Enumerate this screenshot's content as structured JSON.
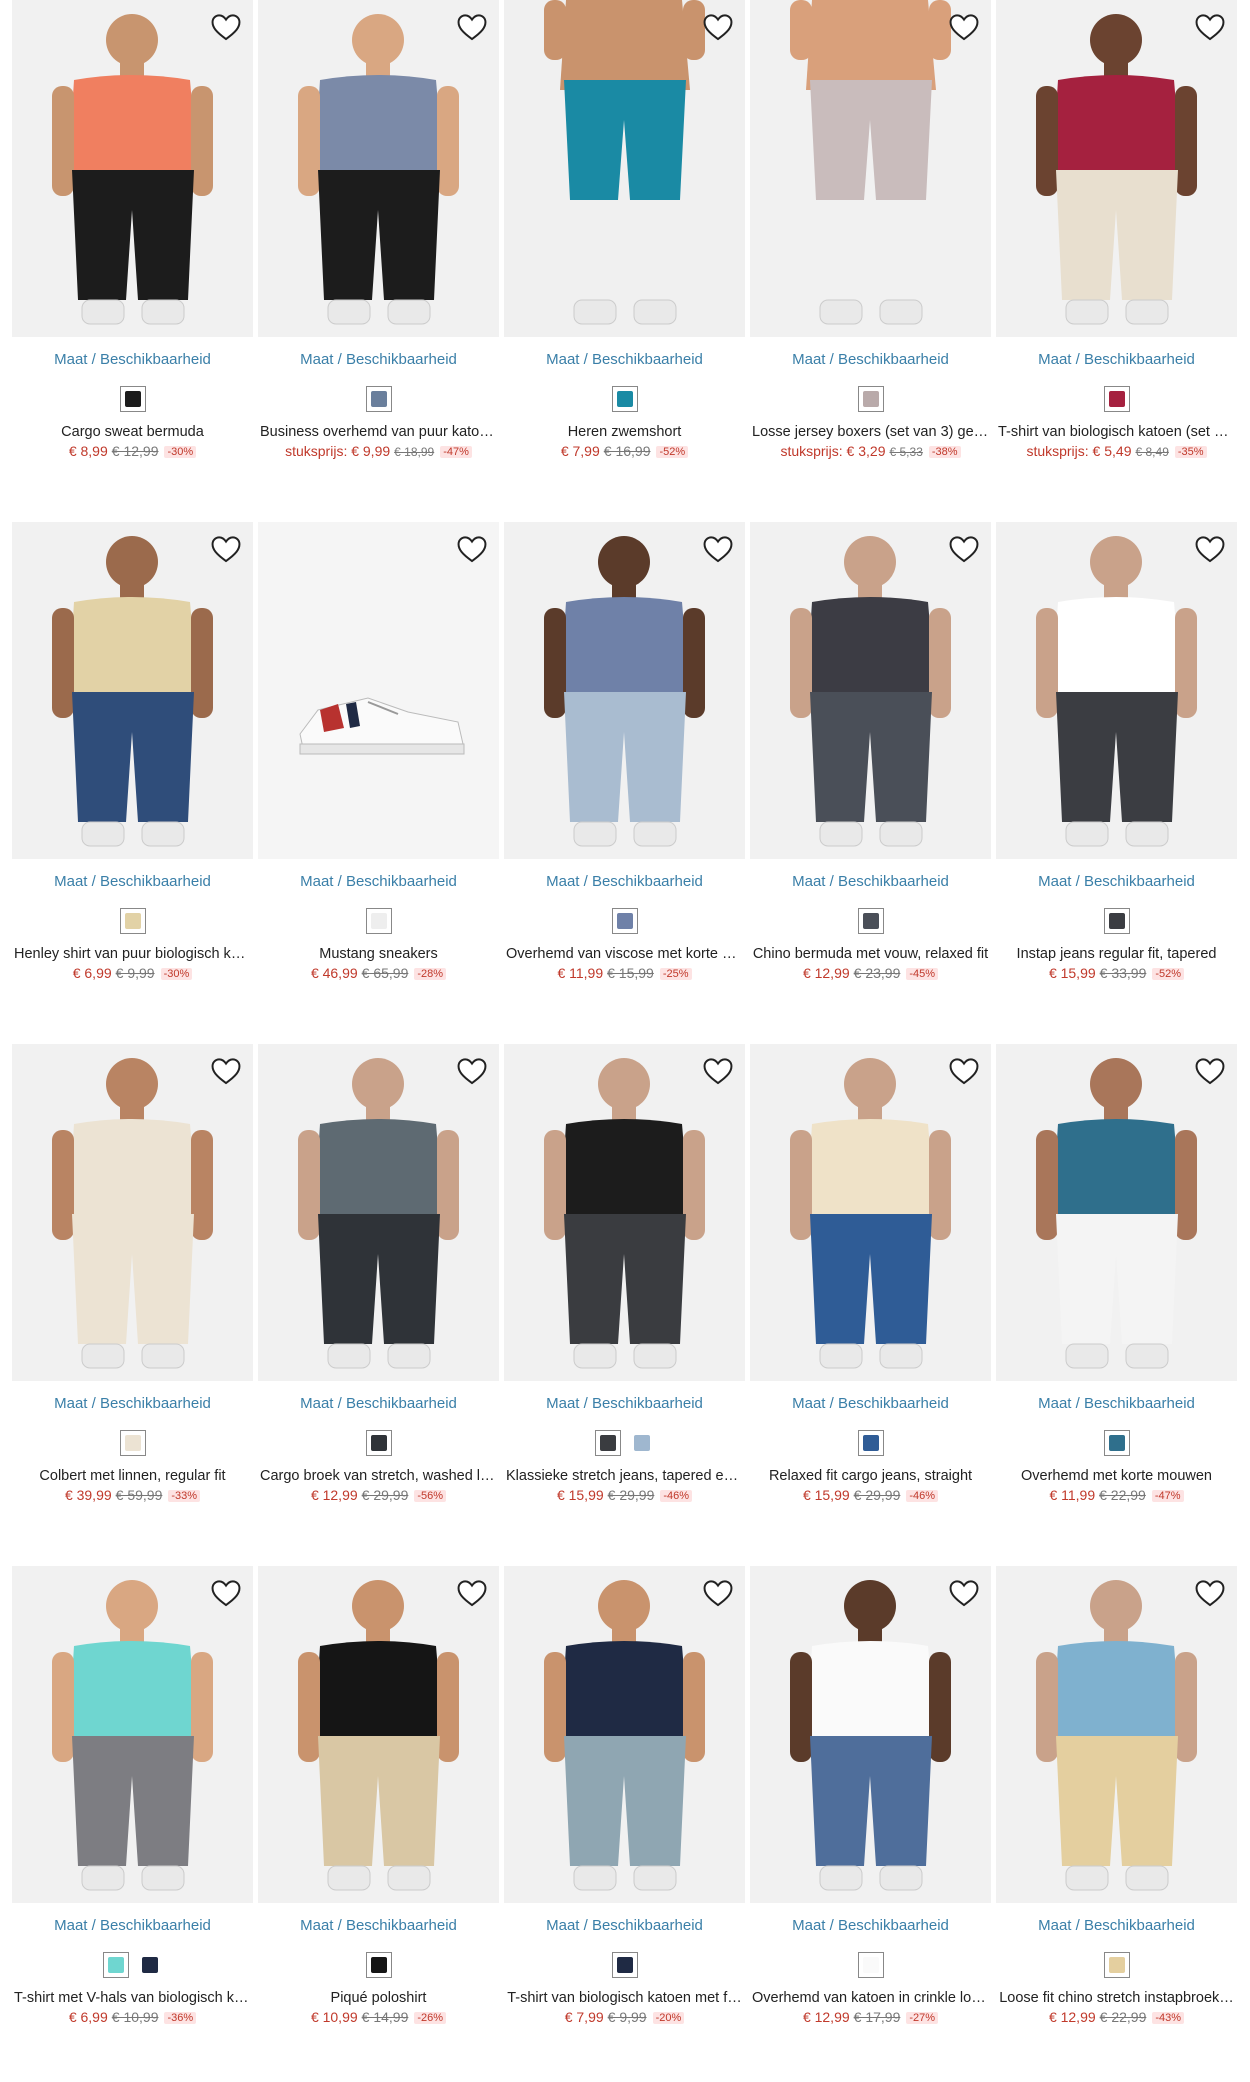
{
  "maat_label": "Maat / Beschikbaarheid",
  "products": [
    {
      "name": "Cargo sweat bermuda",
      "price": "€ 8,99",
      "old": "€ 12,99",
      "badge": "-30%",
      "bg": "#f1f1f1",
      "top": "#f07f60",
      "bottom": "#1c1c1c",
      "skin": "#c8956f",
      "swatches": [
        "#1c1c1c"
      ]
    },
    {
      "name": "Business overhemd van puur katoe…",
      "price": "stuksprijs: € 9,99",
      "old": "€ 18,99",
      "badge": "-47%",
      "bg": "#f1f1f1",
      "top": "#7b8aa8",
      "bottom": "#1c1c1c",
      "skin": "#d9a782",
      "swatches": [
        "#6a7f9c"
      ]
    },
    {
      "name": "Heren zwemshort",
      "price": "€ 7,99",
      "old": "€ 16,99",
      "badge": "-52%",
      "bg": "#f0f0f0",
      "top": "#c9936d",
      "bottom": "#1a8aa4",
      "skin": "#c9936d",
      "swatches": [
        "#1a8aa4"
      ]
    },
    {
      "name": "Losse jersey boxers (set van 3) geruit",
      "price": "stuksprijs: € 3,29",
      "old": "€ 5,33",
      "badge": "-38%",
      "bg": "#f1f1f1",
      "top": "#d9a07b",
      "bottom": "#c9bcbc",
      "skin": "#d9a07b",
      "swatches": [
        "#b9aaaa"
      ]
    },
    {
      "name": "T-shirt van biologisch katoen (set va…",
      "price": "stuksprijs: € 5,49",
      "old": "€ 8,49",
      "badge": "-35%",
      "bg": "#f1f1f1",
      "top": "#a5213f",
      "bottom": "#e8dfcf",
      "skin": "#6b4330",
      "swatches": [
        "#a5213f"
      ]
    },
    {
      "name": "Henley shirt van puur biologisch ka…",
      "price": "€ 6,99",
      "old": "€ 9,99",
      "badge": "-30%",
      "bg": "#f1f1f1",
      "top": "#e2d2a6",
      "bottom": "#2f4d7a",
      "skin": "#9b6a4c",
      "swatches": [
        "#e2d2a6"
      ]
    },
    {
      "name": "Mustang sneakers",
      "price": "€ 46,99",
      "old": "€ 65,99",
      "badge": "-28%",
      "bg": "#f5f5f5",
      "top": "#f5f5f5",
      "bottom": "#f5f5f5",
      "skin": "#f5f5f5",
      "swatches": [
        "#eeeeee"
      ],
      "shoe": true
    },
    {
      "name": "Overhemd van viscose met korte m…",
      "price": "€ 11,99",
      "old": "€ 15,99",
      "badge": "-25%",
      "bg": "#f1f1f1",
      "top": "#6f81a8",
      "bottom": "#a9bcd0",
      "skin": "#5b3b2a",
      "swatches": [
        "#6f81a8"
      ]
    },
    {
      "name": "Chino bermuda met vouw, relaxed fit",
      "price": "€ 12,99",
      "old": "€ 23,99",
      "badge": "-45%",
      "bg": "#f1f1f1",
      "top": "#3c3c44",
      "bottom": "#4a4f58",
      "skin": "#c9a28a",
      "swatches": [
        "#4a4f58"
      ]
    },
    {
      "name": "Instap jeans regular fit, tapered",
      "price": "€ 15,99",
      "old": "€ 33,99",
      "badge": "-52%",
      "bg": "#f1f1f1",
      "top": "#ffffff",
      "bottom": "#3b3d42",
      "skin": "#c9a28a",
      "swatches": [
        "#3b3d42"
      ]
    },
    {
      "name": "Colbert met linnen, regular fit",
      "price": "€ 39,99",
      "old": "€ 59,99",
      "badge": "-33%",
      "bg": "#f1f1f1",
      "top": "#ece3d3",
      "bottom": "#ece3d3",
      "skin": "#b98463",
      "swatches": [
        "#ece3d3"
      ]
    },
    {
      "name": "Cargo broek van stretch, washed lo…",
      "price": "€ 12,99",
      "old": "€ 29,99",
      "badge": "-56%",
      "bg": "#f1f1f1",
      "top": "#5e6a72",
      "bottom": "#2f3338",
      "skin": "#c9a28a",
      "swatches": [
        "#2f3338"
      ]
    },
    {
      "name": "Klassieke stretch jeans, tapered en …",
      "price": "€ 15,99",
      "old": "€ 29,99",
      "badge": "-46%",
      "bg": "#f1f1f1",
      "top": "#1c1c1c",
      "bottom": "#3a3c40",
      "skin": "#c9a28a",
      "swatches": [
        "#3a3c40",
        "#9fb7cf"
      ]
    },
    {
      "name": "Relaxed fit cargo jeans, straight",
      "price": "€ 15,99",
      "old": "€ 29,99",
      "badge": "-46%",
      "bg": "#f1f1f1",
      "top": "#efe2c8",
      "bottom": "#2f5c96",
      "skin": "#c9a28a",
      "swatches": [
        "#2f5c96"
      ]
    },
    {
      "name": "Overhemd met korte mouwen",
      "price": "€ 11,99",
      "old": "€ 22,99",
      "badge": "-47%",
      "bg": "#f1f1f1",
      "top": "#2f6f8c",
      "bottom": "#f4f4f4",
      "skin": "#a9765a",
      "swatches": [
        "#2f6f8c"
      ]
    },
    {
      "name": "T-shirt met V-hals van biologisch ka…",
      "price": "€ 6,99",
      "old": "€ 10,99",
      "badge": "-36%",
      "bg": "#f1f1f1",
      "top": "#6fd6d0",
      "bottom": "#7d7d82",
      "skin": "#d9a782",
      "swatches": [
        "#6fd6d0",
        "#1f2a44"
      ]
    },
    {
      "name": "Piqué poloshirt",
      "price": "€ 10,99",
      "old": "€ 14,99",
      "badge": "-26%",
      "bg": "#f1f1f1",
      "top": "#151515",
      "bottom": "#d9c7a4",
      "skin": "#c9936d",
      "swatches": [
        "#151515"
      ]
    },
    {
      "name": "T-shirt van biologisch katoen met f…",
      "price": "€ 7,99",
      "old": "€ 9,99",
      "badge": "-20%",
      "bg": "#f1f1f1",
      "top": "#1f2a44",
      "bottom": "#8fa6b2",
      "skin": "#c9936d",
      "swatches": [
        "#1f2a44"
      ]
    },
    {
      "name": "Overhemd van katoen in crinkle loo…",
      "price": "€ 12,99",
      "old": "€ 17,99",
      "badge": "-27%",
      "bg": "#f1f1f1",
      "top": "#fafafa",
      "bottom": "#4f6e9b",
      "skin": "#5b3b2a",
      "swatches": [
        "#fafafa"
      ]
    },
    {
      "name": "Loose fit chino stretch instapbroek…",
      "price": "€ 12,99",
      "old": "€ 22,99",
      "badge": "-43%",
      "bg": "#f1f1f1",
      "top": "#7fb1cf",
      "bottom": "#e4cf9f",
      "skin": "#c9a28a",
      "swatches": [
        "#e4cf9f"
      ]
    }
  ]
}
